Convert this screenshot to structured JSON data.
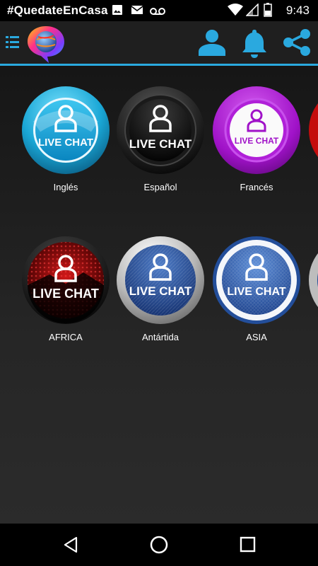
{
  "status_bar": {
    "title": "#QuedateEnCasa",
    "time": "9:43"
  },
  "chat_rooms": [
    {
      "label": "Inglés",
      "badge": "LIVE CHAT"
    },
    {
      "label": "Español",
      "badge": "LIVE CHAT"
    },
    {
      "label": "Francés",
      "badge": "LIVE CHAT"
    },
    {
      "label": "AFRICA",
      "badge": "LIVE CHAT"
    },
    {
      "label": "Antártida",
      "badge": "LIVE CHAT"
    },
    {
      "label": "ASIA",
      "badge": "LIVE CHAT"
    }
  ],
  "colors": {
    "accent": "#2aa9df",
    "background": "#1e1e1e",
    "status_bar": "#000000"
  },
  "icons": {
    "menu": "menu-icon",
    "profile": "user-icon",
    "notifications": "bell-icon",
    "share": "share-icon"
  }
}
